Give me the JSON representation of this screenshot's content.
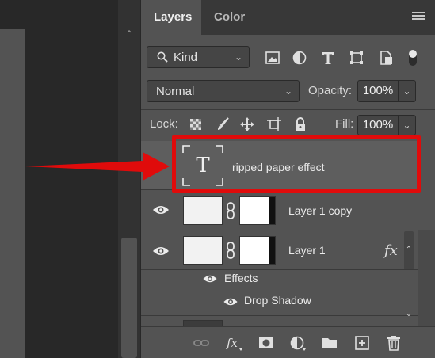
{
  "panel": {
    "tabs": [
      {
        "label": "Layers",
        "active": true
      },
      {
        "label": "Color",
        "active": false
      }
    ],
    "menu_icon": "hamburger-menu-icon"
  },
  "filter": {
    "kind_label": "Kind",
    "icons": [
      "pixel-filter-icon",
      "adjustment-filter-icon",
      "type-filter-icon",
      "shape-filter-icon",
      "smart-object-filter-icon",
      "filter-toggle-icon"
    ]
  },
  "blend": {
    "mode": "Normal",
    "opacity_label": "Opacity:",
    "opacity_value": "100%"
  },
  "lock": {
    "label": "Lock:",
    "icons": [
      "lock-transparent-pixels-icon",
      "lock-image-pixels-icon",
      "lock-position-icon",
      "lock-artboard-icon",
      "lock-all-icon"
    ],
    "fill_label": "Fill:",
    "fill_value": "100%"
  },
  "layers": [
    {
      "name": "ripped paper effect",
      "type": "text",
      "visible": false,
      "highlighted": true
    },
    {
      "name": "Layer 1 copy",
      "type": "pixel",
      "visible": true,
      "has_mask": true
    },
    {
      "name": "Layer 1",
      "type": "pixel",
      "visible": true,
      "has_mask": true,
      "fx": "fx",
      "effects_label": "Effects",
      "effects": [
        {
          "name": "Drop Shadow",
          "visible": true
        }
      ]
    }
  ],
  "bottom_toolbar": [
    "link-layers-icon",
    "add-style-icon",
    "add-mask-icon",
    "adjustment-layer-icon",
    "group-folder-icon",
    "new-layer-icon",
    "delete-layer-icon"
  ],
  "annotation": {
    "arrow_color": "#e00b0b",
    "box_color": "#e00b0b"
  },
  "colors": {
    "panel_bg": "#535353",
    "tabbar_bg": "#383838",
    "selected_row": "#5e5e5e"
  }
}
